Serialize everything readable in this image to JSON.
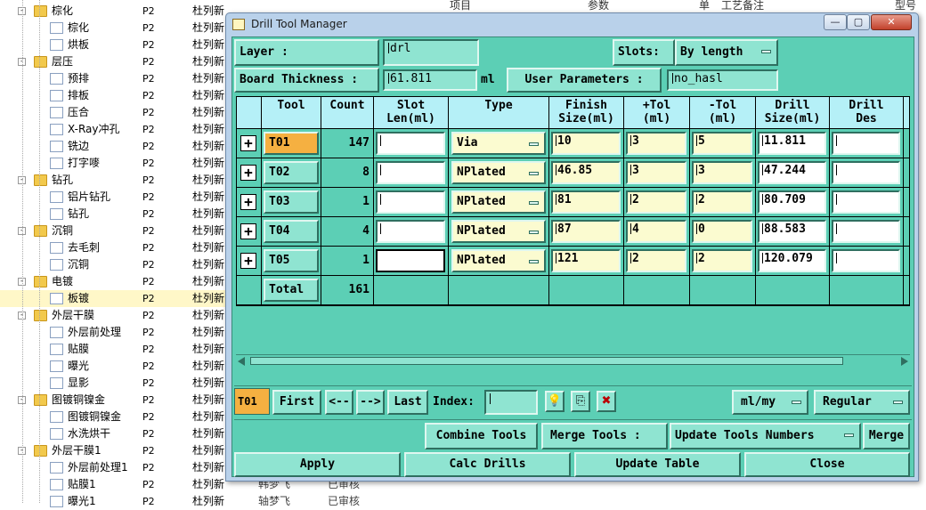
{
  "background_header": {
    "col1": "项目",
    "col2": "参数",
    "col3": "单",
    "col4": "工艺备注",
    "col5": "型号"
  },
  "tree": [
    {
      "label": "棕化",
      "level": 0,
      "kind": "folder",
      "p": "P2",
      "c3": "杜列新",
      "c4": "",
      "c5": ""
    },
    {
      "label": "棕化",
      "level": 1,
      "kind": "file",
      "p": "P2",
      "c3": "杜列新",
      "c4": "",
      "c5": ""
    },
    {
      "label": "烘板",
      "level": 1,
      "kind": "file",
      "p": "P2",
      "c3": "杜列新",
      "c4": "",
      "c5": ""
    },
    {
      "label": "层压",
      "level": 0,
      "kind": "folder",
      "p": "P2",
      "c3": "杜列新",
      "c4": "",
      "c5": ""
    },
    {
      "label": "预排",
      "level": 1,
      "kind": "file",
      "p": "P2",
      "c3": "杜列新",
      "c4": "",
      "c5": ""
    },
    {
      "label": "排板",
      "level": 1,
      "kind": "file",
      "p": "P2",
      "c3": "杜列新",
      "c4": "",
      "c5": ""
    },
    {
      "label": "压合",
      "level": 1,
      "kind": "file",
      "p": "P2",
      "c3": "杜列新",
      "c4": "",
      "c5": ""
    },
    {
      "label": "X-Ray冲孔",
      "level": 1,
      "kind": "file",
      "p": "P2",
      "c3": "杜列新",
      "c4": "",
      "c5": ""
    },
    {
      "label": "铣边",
      "level": 1,
      "kind": "file",
      "p": "P2",
      "c3": "杜列新",
      "c4": "",
      "c5": ""
    },
    {
      "label": "打字嘜",
      "level": 1,
      "kind": "file",
      "p": "P2",
      "c3": "杜列新",
      "c4": "",
      "c5": ""
    },
    {
      "label": "钻孔",
      "level": 0,
      "kind": "folder",
      "p": "P2",
      "c3": "杜列新",
      "c4": "",
      "c5": ""
    },
    {
      "label": "铝片钻孔",
      "level": 1,
      "kind": "file",
      "p": "P2",
      "c3": "杜列新",
      "c4": "",
      "c5": ""
    },
    {
      "label": "钻孔",
      "level": 1,
      "kind": "file",
      "p": "P2",
      "c3": "杜列新",
      "c4": "",
      "c5": ""
    },
    {
      "label": "沉铜",
      "level": 0,
      "kind": "folder",
      "p": "P2",
      "c3": "杜列新",
      "c4": "",
      "c5": ""
    },
    {
      "label": "去毛刺",
      "level": 1,
      "kind": "file",
      "p": "P2",
      "c3": "杜列新",
      "c4": "",
      "c5": ""
    },
    {
      "label": "沉铜",
      "level": 1,
      "kind": "file",
      "p": "P2",
      "c3": "杜列新",
      "c4": "",
      "c5": ""
    },
    {
      "label": "电镀",
      "level": 0,
      "kind": "folder",
      "p": "P2",
      "c3": "杜列新",
      "c4": "",
      "c5": ""
    },
    {
      "label": "板镀",
      "level": 1,
      "kind": "file",
      "p": "P2",
      "c3": "杜列新",
      "c4": "",
      "c5": "",
      "selected": true
    },
    {
      "label": "外层干膜",
      "level": 0,
      "kind": "folder",
      "p": "P2",
      "c3": "杜列新",
      "c4": "",
      "c5": ""
    },
    {
      "label": "外层前处理",
      "level": 1,
      "kind": "file",
      "p": "P2",
      "c3": "杜列新",
      "c4": "",
      "c5": ""
    },
    {
      "label": "贴膜",
      "level": 1,
      "kind": "file",
      "p": "P2",
      "c3": "杜列新",
      "c4": "",
      "c5": ""
    },
    {
      "label": "曝光",
      "level": 1,
      "kind": "file",
      "p": "P2",
      "c3": "杜列新",
      "c4": "",
      "c5": ""
    },
    {
      "label": "显影",
      "level": 1,
      "kind": "file",
      "p": "P2",
      "c3": "杜列新",
      "c4": "",
      "c5": ""
    },
    {
      "label": "图镀铜镍金",
      "level": 0,
      "kind": "folder",
      "p": "P2",
      "c3": "杜列新",
      "c4": "",
      "c5": ""
    },
    {
      "label": "图镀铜镍金",
      "level": 1,
      "kind": "file",
      "p": "P2",
      "c3": "杜列新",
      "c4": "",
      "c5": ""
    },
    {
      "label": "水洗烘干",
      "level": 1,
      "kind": "file",
      "p": "P2",
      "c3": "杜列新",
      "c4": "",
      "c5": ""
    },
    {
      "label": "外层干膜1",
      "level": 0,
      "kind": "folder",
      "p": "P2",
      "c3": "杜列新",
      "c4": "",
      "c5": ""
    },
    {
      "label": "外层前处理1",
      "level": 1,
      "kind": "file",
      "p": "P2",
      "c3": "杜列新",
      "c4": "",
      "c5": ""
    },
    {
      "label": "贴膜1",
      "level": 1,
      "kind": "file",
      "p": "P2",
      "c3": "杜列新",
      "c4": "韩梦飞",
      "c5": "已审核"
    },
    {
      "label": "曝光1",
      "level": 1,
      "kind": "file",
      "p": "P2",
      "c3": "杜列新",
      "c4": "轴梦飞",
      "c5": "已审核"
    }
  ],
  "window": {
    "title": "Drill Tool Manager",
    "min_label": "—",
    "max_label": "▢",
    "close_label": "✕"
  },
  "top": {
    "layer_label": "Layer          :",
    "layer_value": "drl",
    "slots_label": "Slots:",
    "slots_value": "By length",
    "thickness_label": "Board Thickness :",
    "thickness_value": "61.811",
    "thickness_unit": "ml",
    "user_params_label": "User Parameters :",
    "user_params_value": "no_hasl"
  },
  "table": {
    "headers": [
      "Tool",
      "Count",
      "Slot\nLen(ml)",
      "Type",
      "Finish\nSize(ml)",
      "+Tol\n(ml)",
      "-Tol\n(ml)",
      "Drill\nSize(ml)",
      "Drill\nDes"
    ],
    "rows": [
      {
        "tool": "T01",
        "count": "147",
        "slot": "",
        "type": "Via",
        "finish": "10",
        "ptol": "3",
        "mtol": "5",
        "drill": "11.811",
        "des": "",
        "selected": true
      },
      {
        "tool": "T02",
        "count": "8",
        "slot": "",
        "type": "NPlated",
        "finish": "46.85",
        "ptol": "3",
        "mtol": "3",
        "drill": "47.244",
        "des": ""
      },
      {
        "tool": "T03",
        "count": "1",
        "slot": "",
        "type": "NPlated",
        "finish": "81",
        "ptol": "2",
        "mtol": "2",
        "drill": "80.709",
        "des": ""
      },
      {
        "tool": "T04",
        "count": "4",
        "slot": "",
        "type": "NPlated",
        "finish": "87",
        "ptol": "4",
        "mtol": "0",
        "drill": "88.583",
        "des": ""
      },
      {
        "tool": "T05",
        "count": "1",
        "slot": "",
        "type": "NPlated",
        "finish": "121",
        "ptol": "2",
        "mtol": "2",
        "drill": "120.079",
        "des": ""
      }
    ],
    "total_label": "Total",
    "total_count": "161"
  },
  "nav": {
    "current": "T01",
    "first": "First",
    "prev": "<--",
    "next": "-->",
    "last": "Last",
    "index_label": "Index:",
    "index_value": "",
    "units": "ml/my",
    "mode": "Regular"
  },
  "actions": {
    "combine": "Combine Tools",
    "merge_label": "Merge Tools :",
    "update_numbers": "Update Tools Numbers",
    "merge": "Merge",
    "apply": "Apply",
    "calc": "Calc Drills",
    "update_table": "Update Table",
    "close": "Close"
  },
  "colors": {
    "client_bg": "#5ccfb5",
    "button": "#8fe4d1",
    "selected_tool": "#f5b041",
    "header_cell": "#b5f0f7",
    "input_yellow": "#fbfbd0"
  }
}
